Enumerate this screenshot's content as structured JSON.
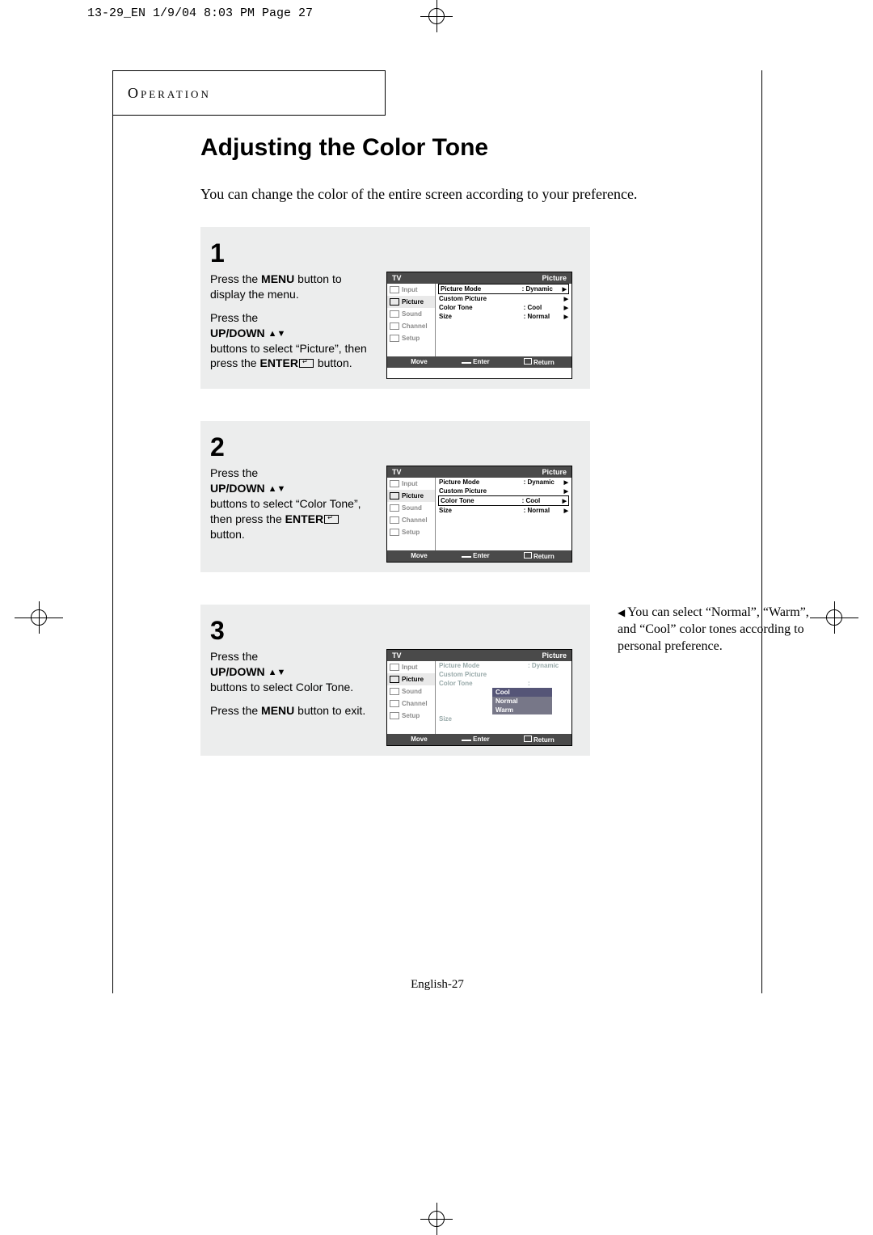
{
  "stamp": "13-29_EN  1/9/04 8:03 PM  Page 27",
  "section_label": "Operation",
  "title": "Adjusting the Color Tone",
  "intro": "You can change the color of the entire screen according to your preference.",
  "steps": {
    "s1": {
      "num": "1",
      "p1a": "Press the ",
      "p1b": "MENU",
      "p1c": " button to display the menu.",
      "p2a": "Press the ",
      "p2b": "UP/DOWN",
      "p2c": " buttons to select “Picture”, then press the ",
      "p2d": "ENTER",
      "p2e": " button."
    },
    "s2": {
      "num": "2",
      "p1a": "Press the ",
      "p1b": "UP/DOWN",
      "p1c": " buttons to select “Color Tone”, then press the ",
      "p1d": "ENTER",
      "p1e": " button."
    },
    "s3": {
      "num": "3",
      "p1a": "Press the ",
      "p1b": "UP/DOWN",
      "p1c": " buttons to select Color Tone.",
      "p2a": "Press the ",
      "p2b": "MENU",
      "p2c": " button to exit."
    }
  },
  "osd": {
    "hdr_left": "TV",
    "hdr_right": "Picture",
    "side": [
      "Input",
      "Picture",
      "Sound",
      "Channel",
      "Setup"
    ],
    "rows": {
      "picture_mode": "Picture Mode",
      "custom_picture": "Custom Picture",
      "color_tone": "Color Tone",
      "size": "Size",
      "dynamic": "Dynamic",
      "cool": "Cool",
      "normal": "Normal",
      "warm": "Warm"
    },
    "footer": {
      "move": "Move",
      "enter": "Enter",
      "return": "Return"
    }
  },
  "sidenote": "You can select “Normal”, “Warm”, and “Cool” color tones according to personal preference.",
  "footer_page": "English-27"
}
